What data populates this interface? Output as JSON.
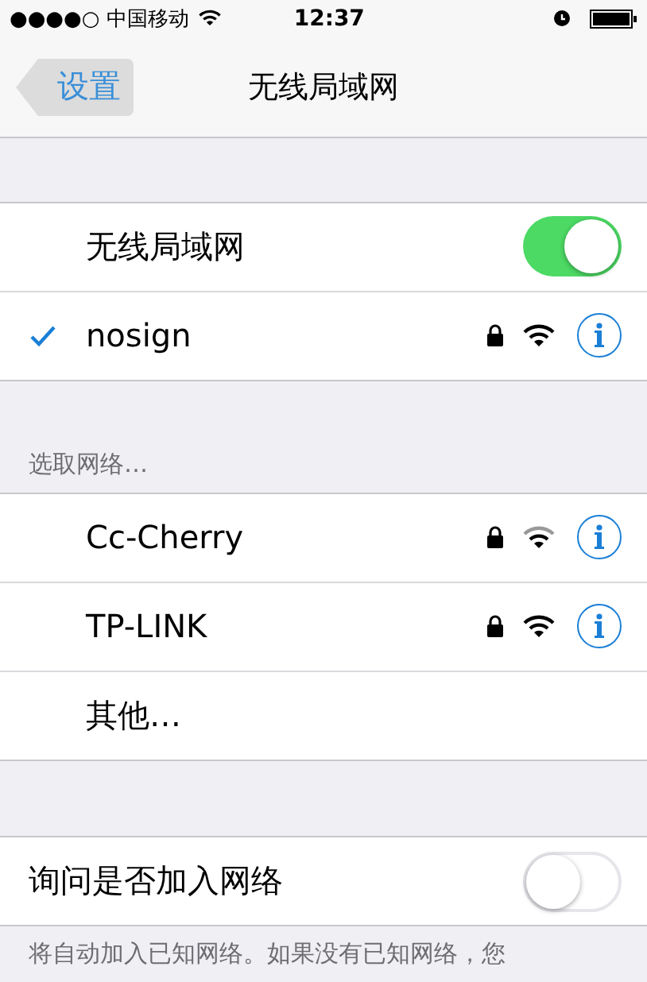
{
  "status_bar": {
    "carrier": "●●●●○ 中国移动",
    "time": "12:37"
  },
  "nav": {
    "back": "设置",
    "title": "无线局域网"
  },
  "wifi_toggle": {
    "label": "无线局域网",
    "on": true
  },
  "connected": {
    "name": "nosign",
    "selected": true,
    "locked": true,
    "full_signal": true
  },
  "networks_header": "选取网络…",
  "networks": [
    {
      "name": "Cc-Cherry",
      "kind": "network",
      "locked": true,
      "full_signal": false
    },
    {
      "name": "TP-LINK",
      "kind": "network",
      "locked": true,
      "full_signal": true
    },
    {
      "name": "其他…",
      "kind": "other"
    }
  ],
  "ask_join": {
    "label": "询问是否加入网络",
    "on": false
  },
  "footer": "将自动加入已知网络。如果没有已知网络，您"
}
